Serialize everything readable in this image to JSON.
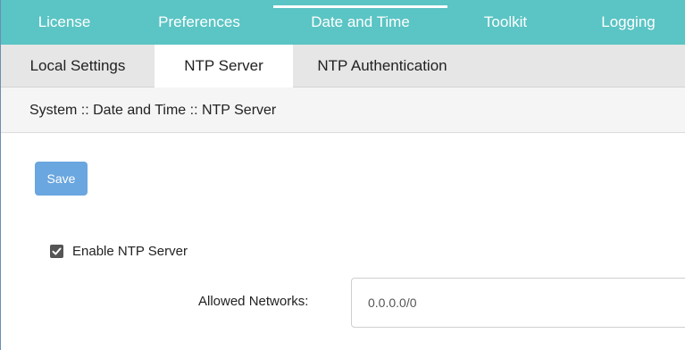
{
  "top_tabs": [
    {
      "label": "License"
    },
    {
      "label": "Preferences"
    },
    {
      "label": "Date and Time"
    },
    {
      "label": "Toolkit"
    },
    {
      "label": "Logging"
    }
  ],
  "active_top_tab": "Date and Time",
  "sub_tabs": [
    {
      "label": "Local Settings"
    },
    {
      "label": "NTP Server"
    },
    {
      "label": "NTP Authentication"
    }
  ],
  "active_sub_tab": "NTP Server",
  "breadcrumb": "System :: Date and Time :: NTP Server",
  "save_label": "Save",
  "enable_ntp": {
    "label": "Enable NTP Server",
    "checked": true
  },
  "allowed_networks": {
    "label": "Allowed Networks:",
    "value": "0.0.0.0/0"
  },
  "colors": {
    "nav": "#5bc4c4",
    "button": "#6aa6df"
  }
}
